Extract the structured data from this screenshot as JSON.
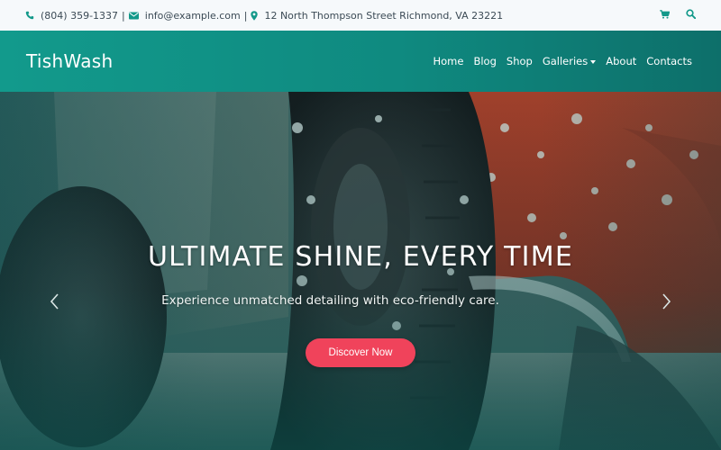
{
  "topbar": {
    "phone": "(804) 359-1337",
    "email": "info@example.com",
    "address": "12 North Thompson Street Richmond, VA 23221",
    "icons": [
      "phone-icon",
      "envelope-icon",
      "map-marker-icon",
      "cart-icon",
      "search-icon"
    ]
  },
  "header": {
    "brand": "TishWash",
    "nav": {
      "home": "Home",
      "blog": "Blog",
      "shop": "Shop",
      "galleries": "Galleries",
      "about": "About",
      "contacts": "Contacts"
    }
  },
  "hero": {
    "headline": "ULTIMATE SHINE, EVERY TIME",
    "subline": "Experience unmatched detailing with eco-friendly care.",
    "cta": "Discover Now"
  },
  "colors": {
    "accent": "#13998a",
    "nav_gradient_start": "#129a8c",
    "nav_gradient_end": "#0d6f6a",
    "cta": "#f0435b",
    "topbar_bg": "#f6f9fb"
  }
}
